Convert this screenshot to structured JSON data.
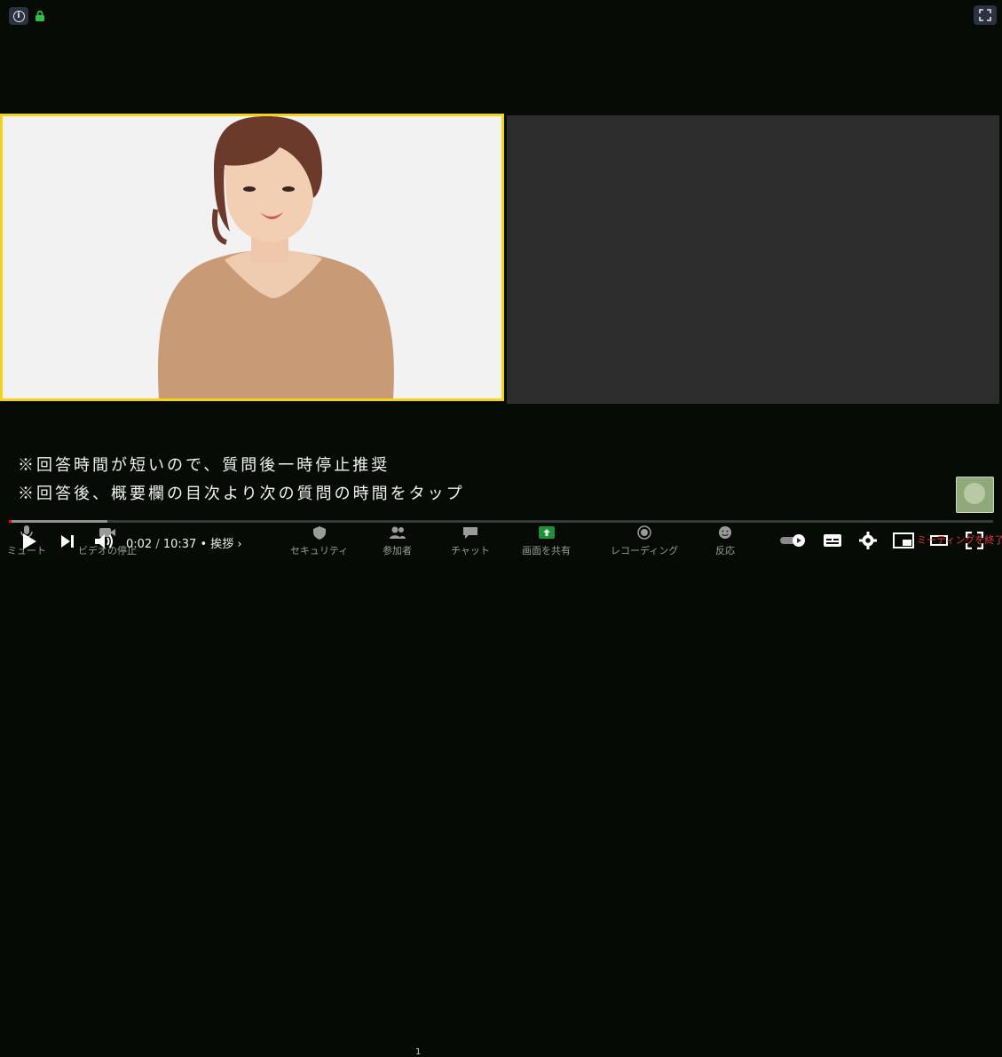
{
  "caption": {
    "line1": "※回答時間が短いので、質問後一時停止推奨",
    "line2": "※回答後、概要欄の目次より次の質問の時間をタップ"
  },
  "zoom_toolbar": {
    "items": [
      {
        "label": "ミュート"
      },
      {
        "label": "ビデオの停止"
      },
      {
        "label": "セキュリティ"
      },
      {
        "label": "参加者"
      },
      {
        "label": "チャット"
      },
      {
        "label": "画面を共有"
      },
      {
        "label": "レコーディング"
      },
      {
        "label": "反応"
      }
    ],
    "participant_count": "1",
    "end_label": "ミーティングを終了"
  },
  "player": {
    "current_time": "0:02",
    "separator": " / ",
    "duration": "10:37",
    "chapter": "• 挨拶",
    "chapter_chevron": "›",
    "progress_played": 0.003,
    "progress_loaded": 0.1
  },
  "colors": {
    "active_speaker_border": "#f3d21b",
    "progress_red": "#ff0000",
    "share_green": "#22c55e"
  },
  "icons": [
    "info-icon",
    "lock-icon",
    "fullscreen-exit-icon",
    "mic-icon",
    "video-camera-icon",
    "shield-icon",
    "participants-icon",
    "chat-icon",
    "share-screen-icon",
    "record-icon",
    "reaction-icon",
    "play-icon",
    "next-icon",
    "volume-icon",
    "autoplay-toggle-icon",
    "subtitles-icon",
    "settings-icon",
    "miniplayer-icon",
    "theater-icon",
    "fullscreen-icon"
  ]
}
